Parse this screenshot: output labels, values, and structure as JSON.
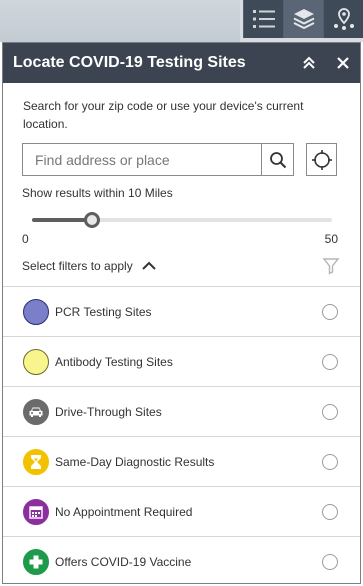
{
  "toolbar": {
    "buttons": [
      {
        "icon": "list-icon"
      },
      {
        "icon": "layers-icon"
      },
      {
        "icon": "map-pin-icon"
      }
    ]
  },
  "panel": {
    "title": "Locate COVID-19 Testing Sites",
    "intro": "Search for your zip code or use your device's current location.",
    "search": {
      "placeholder": "Find address or place",
      "value": ""
    },
    "radius_label": "Show results within 10 Miles",
    "slider": {
      "min": "0",
      "max": "50",
      "value": 10
    },
    "filters_label": "Select filters to apply"
  },
  "filters": [
    {
      "label": "PCR Testing Sites",
      "icon": "circle",
      "color": "#7b7fc9",
      "border": "#2d2f6e",
      "checked": false
    },
    {
      "label": "Antibody Testing Sites",
      "icon": "circle",
      "color": "#f7f58c",
      "border": "#6e6c2d",
      "checked": false
    },
    {
      "label": "Drive-Through Sites",
      "icon": "car-icon",
      "color": "#6b6b6b",
      "border": "#6b6b6b",
      "checked": false
    },
    {
      "label": "Same-Day Diagnostic Results",
      "icon": "hourglass-icon",
      "color": "#f2c100",
      "border": "#f2c100",
      "checked": false
    },
    {
      "label": "No Appointment Required",
      "icon": "calendar-icon",
      "color": "#8b2f9e",
      "border": "#8b2f9e",
      "checked": false
    },
    {
      "label": "Offers COVID-19 Vaccine",
      "icon": "plus-cross-icon",
      "color": "#1e9a4b",
      "border": "#1e9a4b",
      "checked": false
    }
  ],
  "colors": {
    "header_bg": "#3d4451",
    "toolbar_bg": "#3e4a58"
  }
}
